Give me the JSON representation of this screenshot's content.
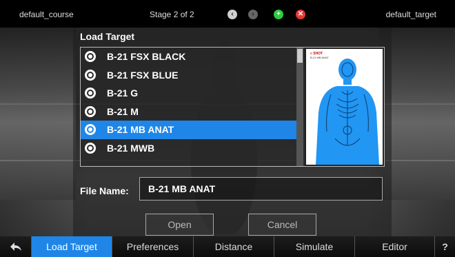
{
  "topbar": {
    "course": "default_course",
    "stage": "Stage 2 of 2",
    "target": "default_target",
    "icons": [
      "chevron-left-icon",
      "chevron-right-icon",
      "add-icon",
      "close-icon"
    ]
  },
  "dialog": {
    "title": "Load Target",
    "items": [
      {
        "label": "B-21 FSX BLACK",
        "selected": false
      },
      {
        "label": "B-21 FSX BLUE",
        "selected": false
      },
      {
        "label": "B-21 G",
        "selected": false
      },
      {
        "label": "B-21 M",
        "selected": false
      },
      {
        "label": "B-21 MB ANAT",
        "selected": true
      },
      {
        "label": "B-21 MWB",
        "selected": false
      }
    ],
    "file_name_label": "File Name:",
    "file_name_value": "B-21 MB ANAT",
    "open_label": "Open",
    "cancel_label": "Cancel",
    "preview_brand": "≡ SHOT",
    "preview_caption": "B-21 MB ANAT",
    "preview_color": "#2196f3"
  },
  "tabs": {
    "back_icon": "back-arrow-icon",
    "load_target": "Load Target",
    "preferences": "Preferences",
    "distance": "Distance",
    "simulate": "Simulate",
    "editor": "Editor",
    "help": "?"
  },
  "colors": {
    "accent": "#1f86e8",
    "add": "#2ecc40",
    "delete": "#e53935"
  }
}
